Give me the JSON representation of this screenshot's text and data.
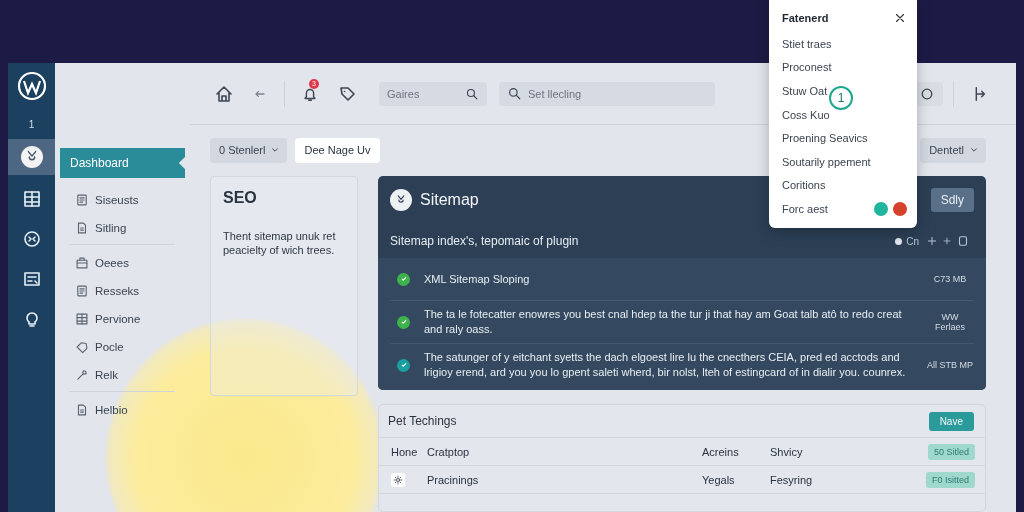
{
  "rail": {
    "count": "1",
    "items": [
      {
        "selected": true
      },
      {
        "selected": false
      },
      {
        "selected": false
      },
      {
        "selected": false
      },
      {
        "selected": false
      }
    ]
  },
  "sidebar": {
    "sections": [
      [
        {
          "label": "Dashboard",
          "selected": true
        },
        {
          "label": "Siseusts",
          "selected": false
        },
        {
          "label": "Sitling",
          "selected": false
        }
      ],
      [
        {
          "label": "Oeees",
          "selected": false
        },
        {
          "label": "Resseks",
          "selected": false
        },
        {
          "label": "Pervione",
          "selected": false
        },
        {
          "label": "Pocle",
          "selected": false
        },
        {
          "label": "Relk",
          "selected": false
        }
      ],
      [
        {
          "label": "Helbio",
          "selected": false
        }
      ]
    ]
  },
  "toolbar": {
    "notification_count": "3",
    "search_small": {
      "placeholder": "Gaires"
    },
    "search_large": {
      "placeholder": "Set llecling"
    }
  },
  "filters": {
    "dropdown": "0 Stenlerl",
    "button": "Dee Nage Uv",
    "right_dropdown": "Dentetl"
  },
  "seo_card": {
    "title": "SEO",
    "text": "Thent sitemap unuk ret peacielty of wich trees."
  },
  "sitemap_card": {
    "title": "Sitemap",
    "button": "Sdly",
    "subtitle": "Sitemap index's, tepomaic of plugin",
    "controls_label": "Cn",
    "rows": [
      {
        "text": "XML Sitemap Sloping",
        "meta": "C73 MB",
        "color": "#3cb44b"
      },
      {
        "text": "The ta le fotecatter enowres you best cnal hdep ta the tur ji that hay am Goat talb atô to redo creat and raly oass.",
        "meta": "WW Ferlaes",
        "color": "#3cb44b"
      },
      {
        "text": "The satunger of y eitchant syetts the dach elgoest lire lu the cnecthers CEIA, pred ed acctods and lrigioy erend, ard you you lo gpent saleti wherd, bir nolst, lteh of estingcard of in dialir you. counrex.",
        "meta": "All STB MP",
        "color": "#1a9ea0"
      }
    ]
  },
  "table_card": {
    "title": "Pet Techings",
    "button": "Nave",
    "rows": [
      {
        "kind": "text",
        "lead": "Hone",
        "cells": [
          "Cratptop",
          "Acreins",
          "Shvicy"
        ],
        "status": "50 Sitled"
      },
      {
        "kind": "icon",
        "cells": [
          "Pracinings",
          "Yegals",
          "Fesyring"
        ],
        "status": "F0 Isitted"
      }
    ]
  },
  "menu": {
    "title": "Fatenerd",
    "step": "1",
    "items": [
      {
        "label": "Stiet traes"
      },
      {
        "label": "Proconest"
      },
      {
        "label": "Stuw Oat"
      },
      {
        "label": "Coss Kuo"
      },
      {
        "label": "Proening Seavics"
      },
      {
        "label": "Soutarily ppement"
      },
      {
        "label": "Coritions"
      },
      {
        "label": "Forc aest",
        "dots": [
          {
            "color": "#1fb59e"
          },
          {
            "color": "#d6412e"
          }
        ]
      }
    ]
  }
}
